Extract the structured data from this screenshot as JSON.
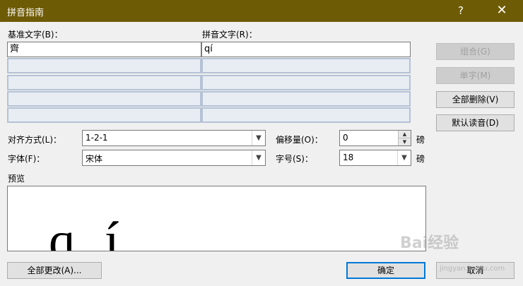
{
  "window": {
    "title": "拼音指南",
    "help_label": "?",
    "close_label": "✕"
  },
  "columns": {
    "base_label": "基准文字(B)：",
    "pinyin_label": "拼音文字(R)："
  },
  "rows": [
    {
      "base": "齊",
      "pinyin": "qí"
    },
    {
      "base": "",
      "pinyin": ""
    },
    {
      "base": "",
      "pinyin": ""
    },
    {
      "base": "",
      "pinyin": ""
    },
    {
      "base": "",
      "pinyin": ""
    }
  ],
  "side_buttons": {
    "combine": "组合(G)",
    "single": "单字(M)",
    "delete_all": "全部删除(V)",
    "default_reading": "默认读音(D)"
  },
  "options": {
    "alignment_label": "对齐方式(L)：",
    "alignment_value": "1-2-1",
    "font_label": "字体(F)：",
    "font_value": "宋体",
    "offset_label": "偏移量(O)：",
    "offset_value": "0",
    "offset_unit": "磅",
    "size_label": "字号(S)：",
    "size_value": "18",
    "size_unit": "磅"
  },
  "preview": {
    "label": "预览",
    "text": "qí"
  },
  "footer": {
    "change_all": "全部更改(A)...",
    "ok": "确定",
    "cancel": "取消"
  },
  "watermark": {
    "text": "Bai经验",
    "url": "jingyan.baidu.com"
  }
}
